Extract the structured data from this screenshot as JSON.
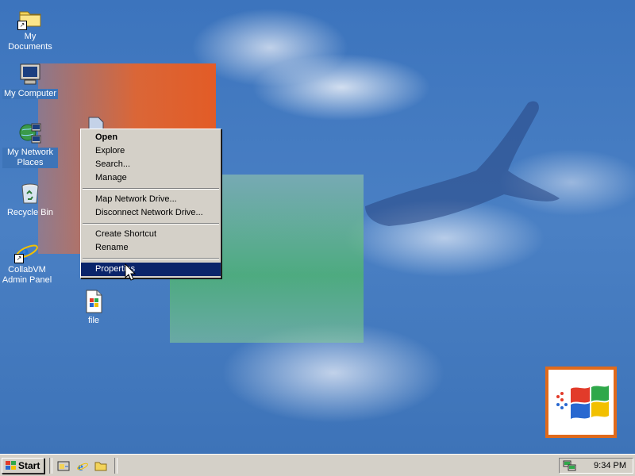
{
  "desktop": {
    "icons": [
      {
        "label": "My Documents"
      },
      {
        "label": "My Computer"
      },
      {
        "label": "My Network Places"
      },
      {
        "label": "Recycle Bin"
      },
      {
        "label": "CollabVM Admin Panel"
      },
      {
        "label": "file"
      }
    ]
  },
  "context_menu": {
    "items": [
      {
        "label": "Open"
      },
      {
        "label": "Explore"
      },
      {
        "label": "Search..."
      },
      {
        "label": "Manage"
      },
      {
        "label": "Map Network Drive..."
      },
      {
        "label": "Disconnect Network Drive..."
      },
      {
        "label": "Create Shortcut"
      },
      {
        "label": "Rename"
      },
      {
        "label": "Properties"
      }
    ],
    "highlighted": "Properties"
  },
  "taskbar": {
    "start_label": "Start",
    "quick_launch": [
      "show-desktop-icon",
      "internet-explorer-icon",
      "folder-icon"
    ],
    "clock": "9:34 PM"
  },
  "colors": {
    "desktop": "#3a6ea5",
    "menu_bg": "#d4d0c8",
    "menu_highlight": "#0a246a",
    "logo_border": "#e06a1b"
  }
}
